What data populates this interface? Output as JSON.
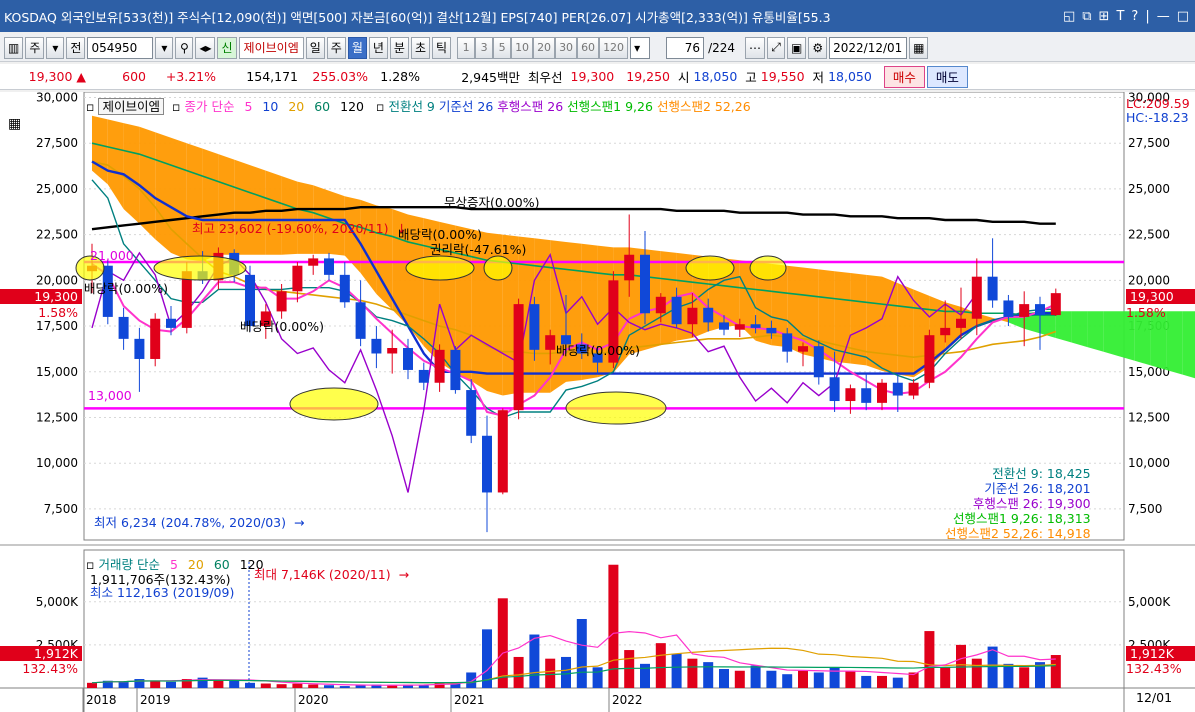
{
  "window": {
    "title": "KOSDAQ 외국인보유[533(천)] 주식수[12,090(천)] 액면[500] 자본금[60(억)] 결산[12월] EPS[740] PER[26.07] 시가총액[2,333(억)] 유통비율[55.3",
    "controls": [
      "◱",
      "⧉",
      "⊞",
      "T",
      "?",
      "|",
      "—",
      "□"
    ]
  },
  "toolbar": {
    "mode": "주",
    "prev_label": "전",
    "code": "054950",
    "stock_name_prefix": "신",
    "stock_name": "제이브이엠",
    "periods": [
      {
        "label": "일",
        "active": false
      },
      {
        "label": "주",
        "active": false
      },
      {
        "label": "월",
        "active": true
      },
      {
        "label": "년",
        "active": false
      },
      {
        "label": "분",
        "active": false
      },
      {
        "label": "초",
        "active": false
      },
      {
        "label": "틱",
        "active": false
      }
    ],
    "intervals": [
      "1",
      "3",
      "5",
      "10",
      "20",
      "30",
      "60",
      "120"
    ],
    "count": "76",
    "total": "/224",
    "date": "2022/12/01"
  },
  "info": {
    "price": "19,300",
    "change": "600",
    "change_pct": "+3.21%",
    "volume": "154,171",
    "vol_ratio": "255.03%",
    "turnover": "1.28%",
    "amount": "2,945백만",
    "best_label": "최우선",
    "ask": "19,300",
    "bid": "19,250",
    "open_label": "시",
    "open": "18,050",
    "high_label": "고",
    "high": "19,550",
    "low_label": "저",
    "low": "18,050",
    "buy_label": "매수",
    "sell_label": "매도"
  },
  "price_legend": {
    "name": "제이브이엠",
    "ma_label": "종가 단순",
    "ma_periods": [
      {
        "p": "5",
        "color": "#ff33cc"
      },
      {
        "p": "10",
        "color": "#1040d0"
      },
      {
        "p": "20",
        "color": "#e0a000"
      },
      {
        "p": "60",
        "color": "#008060"
      },
      {
        "p": "120",
        "color": "#000000"
      }
    ],
    "ichimoku": [
      {
        "text": "전환선 9",
        "color": "#008080"
      },
      {
        "text": "기준선 26",
        "color": "#1040d0"
      },
      {
        "text": "후행스팬 26",
        "color": "#9900cc"
      },
      {
        "text": "선행스팬1 9,26",
        "color": "#00bb00"
      },
      {
        "text": "선행스팬2 52,26",
        "color": "#ff8c00"
      }
    ],
    "lc": "LC:209.59",
    "hc": "HC:-18.23"
  },
  "volume_legend": {
    "label": "거래량 단순",
    "ma": [
      {
        "p": "5",
        "color": "#ff33cc"
      },
      {
        "p": "20",
        "color": "#e0a000"
      },
      {
        "p": "60",
        "color": "#008060"
      },
      {
        "p": "120",
        "color": "#000000"
      }
    ],
    "current": "1,911,706주(132.43%)",
    "min_label": "최소 112,163 (2019/09)",
    "max_label": "최대 7,146K (2020/11)"
  },
  "ichimoku_values": [
    {
      "text": "전환선 9: 18,425",
      "color": "#008080"
    },
    {
      "text": "기준선 26: 18,201",
      "color": "#1040d0"
    },
    {
      "text": "후행스팬 26: 19,300",
      "color": "#9900cc"
    },
    {
      "text": "선행스팬1 9,26: 18,313",
      "color": "#00bb00"
    },
    {
      "text": "선행스팬2 52,26: 14,918",
      "color": "#ff8c00"
    }
  ],
  "annotations": {
    "high": "최고 23,602 (-19.60%, 2020/11)",
    "low": "최저 6,234 (204.78%, 2020/03)",
    "bonus_issue": "무상증자(0.00%)",
    "div1": "배당락(0.00%)",
    "div2": "배당락(0.00%)",
    "div3": "배당락(0.00%)",
    "div4": "배당락(0.00%)",
    "rights": "권리락(-47.61%)",
    "line_hi": "21,000",
    "line_lo": "13,000"
  },
  "right_badges": {
    "price": "19,300",
    "pct": "1.58%",
    "vol": "1,912K",
    "vol_pct": "132.43%"
  },
  "x_axis": {
    "labels": [
      "2018",
      "2019",
      "2020",
      "2021",
      "2022"
    ],
    "end_label": "12/01"
  },
  "chart_data": {
    "type": "candlestick",
    "interval": "month",
    "y_axis": {
      "ticks": [
        "30,000",
        "27,500",
        "25,000",
        "22,500",
        "20,000",
        "17,500",
        "15,000",
        "12,500",
        "10,000",
        "7,500"
      ],
      "range": [
        5800,
        30300
      ]
    },
    "volume_axis": {
      "ticks": [
        "5,000K",
        "2,500K"
      ],
      "range": [
        0,
        8000
      ]
    },
    "horizontal_lines": [
      21000,
      13000
    ],
    "start_month": "2018-01",
    "candles": [
      [
        20500,
        22000,
        19300,
        20800
      ],
      [
        20800,
        21100,
        17600,
        18000
      ],
      [
        18000,
        18500,
        16200,
        16800
      ],
      [
        16800,
        17400,
        13900,
        15700
      ],
      [
        15700,
        18200,
        15300,
        17900
      ],
      [
        17900,
        18600,
        17000,
        17400
      ],
      [
        17400,
        21000,
        17100,
        20500
      ],
      [
        20500,
        21600,
        19800,
        20000
      ],
      [
        20000,
        21800,
        19500,
        21500
      ],
      [
        21500,
        21700,
        19900,
        20300
      ],
      [
        20300,
        20800,
        17200,
        17500
      ],
      [
        17500,
        18700,
        16800,
        18300
      ],
      [
        18300,
        19800,
        17900,
        19400
      ],
      [
        19400,
        21000,
        18800,
        20800
      ],
      [
        20800,
        21400,
        20300,
        21200
      ],
      [
        21200,
        21500,
        20000,
        20300
      ],
      [
        20300,
        21000,
        18500,
        18800
      ],
      [
        18800,
        20000,
        16400,
        16800
      ],
      [
        16800,
        17500,
        15200,
        16000
      ],
      [
        16000,
        17300,
        14900,
        16300
      ],
      [
        16300,
        16800,
        14600,
        15100
      ],
      [
        15100,
        15500,
        14000,
        14400
      ],
      [
        14400,
        16500,
        13900,
        16200
      ],
      [
        16200,
        16400,
        13800,
        14000
      ],
      [
        14000,
        14600,
        11100,
        11500
      ],
      [
        11500,
        12600,
        6234,
        8400
      ],
      [
        8400,
        13000,
        8300,
        12900
      ],
      [
        12900,
        19000,
        12400,
        18700
      ],
      [
        18700,
        19100,
        15600,
        16200
      ],
      [
        16200,
        17300,
        15400,
        17000
      ],
      [
        17000,
        19200,
        16000,
        16500
      ],
      [
        16500,
        17100,
        15700,
        16000
      ],
      [
        16000,
        16400,
        14900,
        15500
      ],
      [
        15500,
        20500,
        15200,
        20000
      ],
      [
        20000,
        23602,
        19100,
        21400
      ],
      [
        21400,
        22700,
        17600,
        18200
      ],
      [
        18200,
        19300,
        17700,
        19100
      ],
      [
        19100,
        19600,
        17400,
        17600
      ],
      [
        17600,
        19300,
        16900,
        18500
      ],
      [
        18500,
        19000,
        17200,
        17700
      ],
      [
        17700,
        18100,
        17000,
        17300
      ],
      [
        17300,
        17900,
        16900,
        17600
      ],
      [
        17600,
        18100,
        17100,
        17400
      ],
      [
        17400,
        17800,
        16800,
        17100
      ],
      [
        17100,
        17400,
        15500,
        16100
      ],
      [
        16100,
        16600,
        15300,
        16400
      ],
      [
        16400,
        16700,
        14300,
        14700
      ],
      [
        14700,
        16100,
        12800,
        13400
      ],
      [
        13400,
        14300,
        12700,
        14100
      ],
      [
        14100,
        14900,
        12900,
        13300
      ],
      [
        13300,
        14600,
        12900,
        14400
      ],
      [
        14400,
        14800,
        12800,
        13700
      ],
      [
        13700,
        14600,
        13500,
        14400
      ],
      [
        14400,
        17300,
        14100,
        17000
      ],
      [
        17000,
        18900,
        16600,
        17400
      ],
      [
        17400,
        19600,
        16800,
        17900
      ],
      [
        17900,
        21200,
        17000,
        20200
      ],
      [
        20200,
        22300,
        18500,
        18900
      ],
      [
        18900,
        19200,
        17500,
        18000
      ],
      [
        18000,
        19400,
        16400,
        18700
      ],
      [
        18700,
        19100,
        16200,
        18100
      ],
      [
        18100,
        19550,
        18050,
        19300
      ]
    ],
    "volume_k": [
      300,
      420,
      380,
      520,
      430,
      360,
      520,
      600,
      480,
      420,
      300,
      260,
      220,
      250,
      200,
      160,
      112,
      150,
      200,
      180,
      200,
      150,
      320,
      300,
      900,
      3400,
      5200,
      1800,
      3100,
      1700,
      1800,
      4000,
      1200,
      7146,
      2200,
      1400,
      2600,
      2000,
      1700,
      1500,
      1100,
      1000,
      1300,
      1000,
      800,
      1000,
      900,
      1200,
      1000,
      700,
      700,
      600,
      900,
      3300,
      1200,
      2500,
      1700,
      2400,
      1400,
      1200,
      1500,
      1912
    ],
    "ma": {
      "ma5": [
        20900,
        20300,
        18600,
        17800,
        17300,
        17200,
        17900,
        18900,
        19900,
        19900,
        19600,
        19600,
        19000,
        19000,
        19400,
        20000,
        19600,
        18800,
        17900,
        17100,
        16300,
        15600,
        15200,
        14900,
        14500,
        12800,
        12600,
        13200,
        13700,
        14700,
        16200,
        16600,
        16200,
        16600,
        17900,
        18300,
        18500,
        19100,
        19300,
        18500,
        18000,
        17500,
        17400,
        17300,
        17000,
        16700,
        16200,
        15600,
        15000,
        14500,
        14000,
        13800,
        13900,
        14500,
        15000,
        15800,
        16800,
        17700,
        18000,
        18000,
        18300,
        18700
      ],
      "ma20": [
        26500,
        26300,
        25700,
        25000,
        24000,
        22800,
        22000,
        21200,
        20500,
        20200,
        19800,
        19500,
        19400,
        19300,
        19200,
        19100,
        19000,
        18900,
        18700,
        18400,
        18100,
        17800,
        17500,
        17300,
        17000,
        16400,
        16100,
        16100,
        16000,
        16000,
        16100,
        16000,
        16000,
        16100,
        16300,
        16400,
        16500,
        16600,
        16700,
        16800,
        16800,
        16800,
        16900,
        17000,
        16900,
        16800,
        16700,
        16500,
        16300,
        16100,
        16000,
        15900,
        15800,
        15900,
        16000,
        16100,
        16300,
        16500,
        16600,
        16700,
        16900,
        17200
      ],
      "ma60": [
        27500,
        27300,
        27100,
        26900,
        26600,
        26300,
        26000,
        25700,
        25400,
        25100,
        24800,
        24500,
        24200,
        23900,
        23700,
        23400,
        23100,
        22900,
        22600,
        22400,
        22100,
        21900,
        21700,
        21500,
        21300,
        21100,
        21000,
        20900,
        20800,
        20700,
        20600,
        20500,
        20400,
        20300,
        20300,
        20200,
        20100,
        20000,
        19900,
        19800,
        19700,
        19600,
        19500,
        19400,
        19300,
        19200,
        19100,
        19000,
        18900,
        18800,
        18700,
        18600,
        18500,
        18400,
        18300,
        18300,
        18200,
        18200,
        18200,
        18100,
        18100,
        18100
      ],
      "ma120": [
        22800,
        22900,
        23000,
        23100,
        23200,
        23300,
        23400,
        23500,
        23600,
        23700,
        23700,
        23800,
        23800,
        23900,
        23900,
        23900,
        23900,
        24000,
        24000,
        24000,
        24000,
        24000,
        24000,
        24000,
        23900,
        23900,
        23900,
        23900,
        23900,
        23900,
        23900,
        23900,
        23900,
        23900,
        23900,
        23900,
        23900,
        23800,
        23800,
        23800,
        23800,
        23700,
        23700,
        23700,
        23700,
        23600,
        23600,
        23600,
        23500,
        23500,
        23500,
        23400,
        23400,
        23400,
        23300,
        23300,
        23300,
        23200,
        23200,
        23200,
        23100,
        23100
      ],
      "ichimoku_base_26": [
        26500,
        26000,
        25800,
        25200,
        24500,
        24000,
        23500,
        23300,
        23300,
        23300,
        23300,
        23300,
        23300,
        23300,
        23300,
        23300,
        23300,
        22000,
        20500,
        19000,
        17500,
        16000,
        15000,
        15000,
        15000,
        14900,
        14900,
        14900,
        14900,
        14900,
        14900,
        14900,
        14900,
        14900,
        14900,
        14900,
        14900,
        14900,
        14900,
        14900,
        14900,
        14900,
        14900,
        14900,
        14900,
        14900,
        14900,
        14900,
        14900,
        14900,
        14900,
        14900,
        14900,
        15500,
        16200,
        17000,
        17500,
        17800,
        18000,
        18100,
        18200,
        18201
      ],
      "ichimoku_conv_9": [
        25500,
        24500,
        22000,
        21000,
        20000,
        19000,
        18800,
        18800,
        19500,
        19500,
        19500,
        19500,
        19500,
        19600,
        19600,
        19600,
        19400,
        18800,
        18000,
        17800,
        17500,
        16800,
        16000,
        14900,
        14000,
        13000,
        12500,
        12800,
        12800,
        12800,
        14000,
        14200,
        14500,
        15000,
        17000,
        17500,
        18000,
        18500,
        18800,
        19500,
        20000,
        20200,
        18500,
        18000,
        17800,
        17000,
        16600,
        16200,
        16000,
        15800,
        15200,
        14800,
        14500,
        15000,
        16000,
        16800,
        17500,
        17800,
        18000,
        18300,
        18400,
        18425
      ]
    }
  }
}
